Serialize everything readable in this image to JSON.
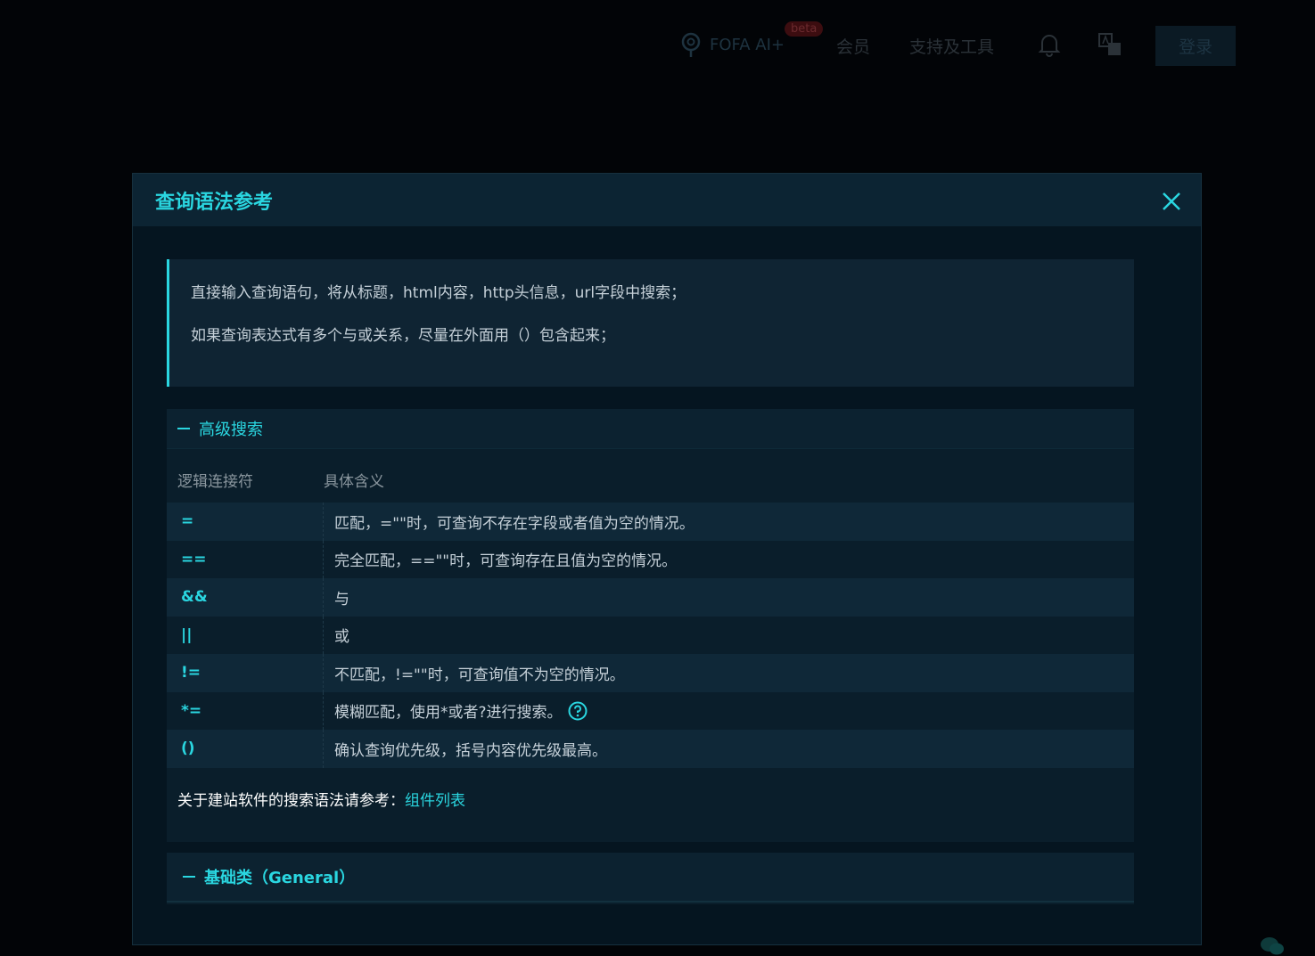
{
  "header": {
    "ai_label": "FOFA AI+",
    "ai_badge": "beta",
    "nav_member": "会员",
    "nav_tools": "支持及工具",
    "login_label": "登录"
  },
  "modal": {
    "title": "查询语法参考",
    "tips": [
      "直接输入查询语句，将从标题，html内容，http头信息，url字段中搜索；",
      "如果查询表达式有多个与或关系，尽量在外面用（）包含起来；"
    ],
    "advanced": {
      "title": "高级搜索",
      "col_operator": "逻辑连接符",
      "col_meaning": "具体含义",
      "rows": [
        {
          "op": "=",
          "desc": "匹配，=\"\"时，可查询不存在字段或者值为空的情况。"
        },
        {
          "op": "==",
          "desc": "完全匹配，==\"\"时，可查询存在且值为空的情况。"
        },
        {
          "op": "&&",
          "desc": "与"
        },
        {
          "op": "||",
          "desc": "或"
        },
        {
          "op": "!=",
          "desc": "不匹配，!=\"\"时，可查询值不为空的情况。"
        },
        {
          "op": "*=",
          "desc": "模糊匹配，使用*或者?进行搜索。"
        },
        {
          "op": "()",
          "desc": "确认查询优先级，括号内容优先级最高。"
        }
      ],
      "ref_text": "关于建站软件的搜索语法请参考：",
      "ref_link": "组件列表"
    },
    "general": {
      "title": "基础类（General）"
    }
  },
  "colors": {
    "accent": "#2ad6e0",
    "background": "#020407",
    "modal_bg": "#051520"
  }
}
